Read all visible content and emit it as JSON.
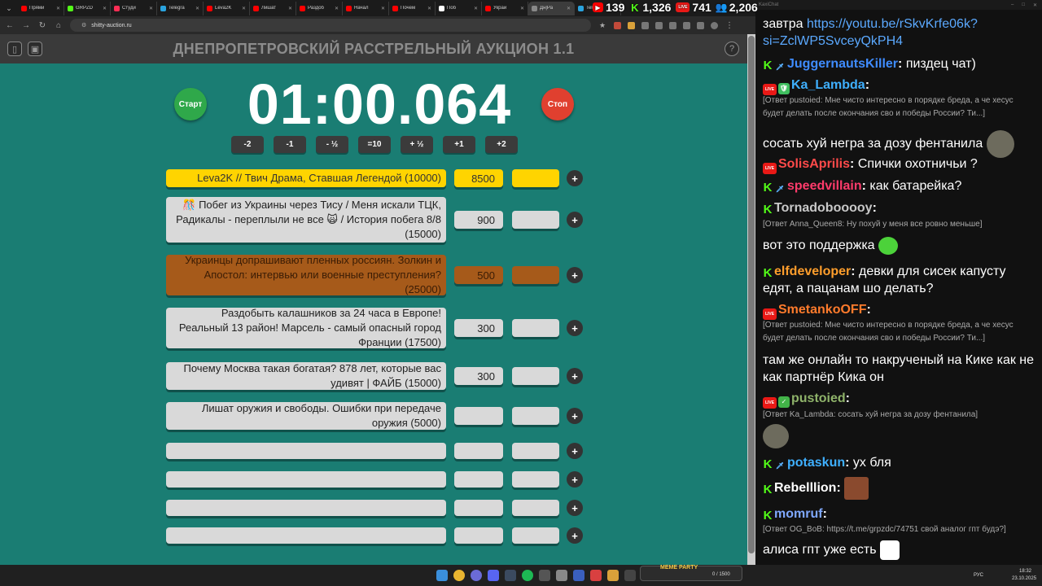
{
  "browser": {
    "tabs": [
      {
        "label": "Прями",
        "color": "#ff0000"
      },
      {
        "label": "GRPZD",
        "color": "#53fc18"
      },
      {
        "label": "Студи",
        "color": "#ff2d55"
      },
      {
        "label": "Telegra",
        "color": "#2aa3de"
      },
      {
        "label": "Leva2K",
        "color": "#ff0000"
      },
      {
        "label": "Лишат",
        "color": "#ff0000"
      },
      {
        "label": "Раздоб",
        "color": "#ff0000"
      },
      {
        "label": "Начал",
        "color": "#ff0000"
      },
      {
        "label": "Почем",
        "color": "#ff0000"
      },
      {
        "label": "Поб",
        "color": "#ffffff"
      },
      {
        "label": "Украи",
        "color": "#ff0000"
      },
      {
        "label": "Дн|Ра",
        "color": "#888888"
      },
      {
        "label": "Tele",
        "color": "#2aa3de"
      }
    ],
    "url": "shitty-auction.ru"
  },
  "stats": {
    "youtube": "139",
    "kick": "1,326",
    "live": "741",
    "total": "2,206"
  },
  "auction": {
    "title": "ДНЕПРОПЕТРОВСКИЙ РАССТРЕЛЬНЫЙ АУКЦИОН 1.1",
    "start_label": "Старт",
    "stop_label": "Стоп",
    "timer": "01:00.064",
    "adjust_buttons": [
      "-2",
      "-1",
      "- ½",
      "=10",
      "+ ½",
      "+1",
      "+2"
    ],
    "lots": [
      {
        "text": "Leva2K // Твич Драма, Ставшая Легендой (10000)",
        "amount": "8500"
      },
      {
        "text": "🎊 Побег из Украины через Тису / Меня искали ТЦК, Радикалы - переплыли не все 🙀 / История побега 8/8 (15000)",
        "amount": "900"
      },
      {
        "text": "Украинцы допрашивают пленных россиян. Золкин и Апостол: интервью или военные преступления? (25000)",
        "amount": "500"
      },
      {
        "text": "Раздобыть калашников за 24 часа в Европе! Реальный 13 район! Марсель - самый опасный город Франции (17500)",
        "amount": "300"
      },
      {
        "text": "Почему Москва такая богатая? 878 лет, которые вас удивят | ФАЙБ (15000)",
        "amount": "300"
      },
      {
        "text": "Лишат оружия и свободы. Ошибки при передаче оружия (5000)",
        "amount": ""
      },
      {
        "text": "",
        "amount": ""
      },
      {
        "text": "",
        "amount": ""
      },
      {
        "text": "",
        "amount": ""
      },
      {
        "text": "",
        "amount": ""
      }
    ],
    "add_label": "+"
  },
  "chat": {
    "window_title": "KaxiChat",
    "messages": [
      {
        "text": "завтра ",
        "link": "https://youtu.be/rSkvKrfe06k?si=ZclWP5SvceyQkPH4"
      },
      {
        "nick": "JuggernautsKiller",
        "nick_color": "#3f8cff",
        "text": "пиздец чат)"
      },
      {
        "nick": "Ka_Lambda",
        "nick_color": "#3fb0ff",
        "reply": "[Ответ pustoied: Мне чисто интересно в порядке бреда, а че хесус будет делать после окончания сво и победы России? Ти...]",
        "text": "сосать хуй негра за дозу фентанила"
      },
      {
        "nick": "SolisAprilis",
        "nick_color": "#ff4a4a",
        "text": "Спички охотничьи ?"
      },
      {
        "nick": "speedvillain",
        "nick_color": "#ff3b6b",
        "text": "как батарейка?"
      },
      {
        "nick": "Tornadobooooy",
        "nick_color": "#c8c8c8",
        "reply": "[Ответ Anna_Queen8: Ну похуй у меня все ровно меньше]",
        "text": "вот это поддержка"
      },
      {
        "nick": "elfdeveloper",
        "nick_color": "#ff9e2c",
        "text": "девки для сисек капусту едят, а пацанам шо делать?"
      },
      {
        "nick": "SmetankoOFF",
        "nick_color": "#ff7b2c",
        "reply": "[Ответ pustoied: Мне чисто интересно в порядке бреда, а че хесус будет делать после окончания сво и победы России? Ти...]",
        "text": "там же онлайн то накрученый на Кике как не как партнёр Кика он"
      },
      {
        "nick": "pustoied",
        "nick_color": "#8fb36a",
        "reply": "[Ответ Ka_Lambda: сосать хуй негра за дозу фентанила]",
        "text": ""
      },
      {
        "nick": "potaskun",
        "nick_color": "#3fb0ff",
        "text": "ух бля"
      },
      {
        "nick": "Rebelllion",
        "nick_color": "#ffffff",
        "text": ""
      },
      {
        "nick": "momruf",
        "nick_color": "#7fa8ff",
        "reply": "[Ответ OG_BoB: https://t.me/grpzdc/74751 свой аналог гпт будэ?]",
        "text": "алиса гпт уже есть"
      }
    ]
  },
  "taskbar": {
    "meme_party": "MEME PARTY",
    "meme_count": "0 / 1500",
    "lang": "РУС",
    "time": "18:32",
    "date": "23.10.2025"
  }
}
